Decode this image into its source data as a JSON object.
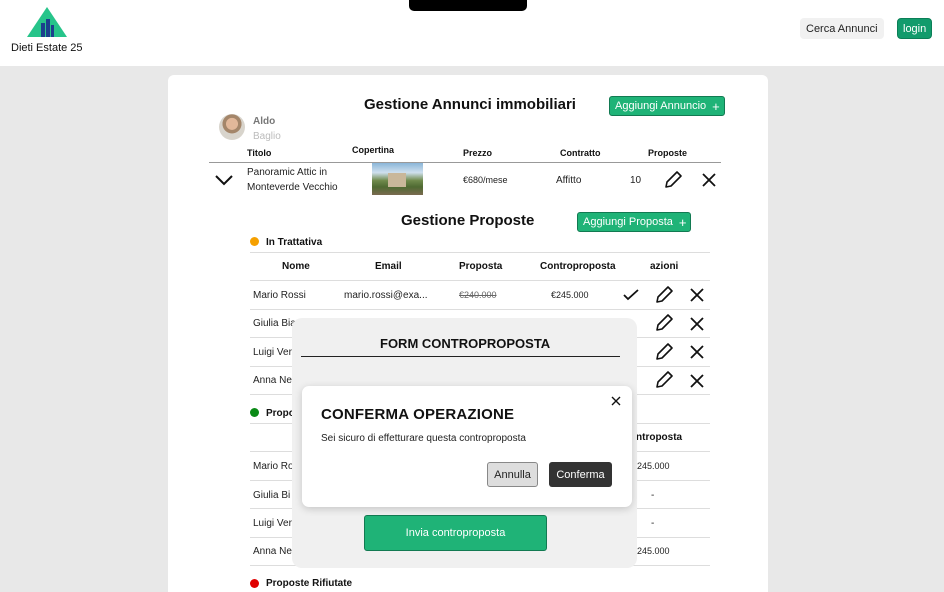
{
  "header": {
    "brand": "Dieti Estate 25",
    "search_button": "Cerca Annunci",
    "login_button": "login",
    "colors": {
      "accent": "#1fb377",
      "logo": "#27c48a"
    }
  },
  "listing_manager": {
    "title": "Gestione Annunci immobiliari",
    "add_button": "Aggiungi Annuncio",
    "add_button_icon": "+",
    "user": {
      "first_name": "Aldo",
      "last_name": "Baglio"
    },
    "columns": [
      "Titolo",
      "Copertina",
      "Prezzo",
      "Contratto",
      "Proposte"
    ],
    "listing": {
      "title_line1": "Panoramic Attic in",
      "title_line2": "Monteverde Vecchio",
      "price": "€680/mese",
      "contract": "Affitto",
      "offers": "10"
    }
  },
  "offers_manager": {
    "title": "Gestione Proposte",
    "add_button": "Aggiungi Proposta",
    "add_button_icon": "+",
    "negotiating": {
      "label": "In Trattativa",
      "color": "#f5a000",
      "columns": [
        "Nome",
        "Email",
        "Proposta",
        "Controproposta",
        "azioni"
      ],
      "rows": [
        {
          "name": "Mario Rossi",
          "email": "mario.rossi@exa...",
          "offer": "€240.000",
          "counter": "€245.000"
        },
        {
          "name": "Giulia Bia"
        },
        {
          "name": "Luigi Ver"
        },
        {
          "name": "Anna Ne"
        }
      ]
    },
    "accepted": {
      "label": "Propo",
      "color": "#0a8a16",
      "counter_header": "ntroposta",
      "rows": [
        {
          "name": "Mario Ro",
          "counter": "245.000"
        },
        {
          "name": "Giulia Bi",
          "counter": "-"
        },
        {
          "name": "Luigi Ver",
          "counter": "-"
        },
        {
          "name": "Anna Ne",
          "counter": "245.000"
        }
      ]
    },
    "rejected": {
      "label": "Proposte Rifiutate",
      "color": "#e00000"
    }
  },
  "counter_form": {
    "title": "FORM CONTROPROPOSTA",
    "submit_button": "Invia controproposta"
  },
  "confirm_dialog": {
    "title": "CONFERMA OPERAZIONE",
    "message": "Sei sicuro di effetturare questa controproposta",
    "cancel_button": "Annulla",
    "confirm_button": "Conferma"
  }
}
